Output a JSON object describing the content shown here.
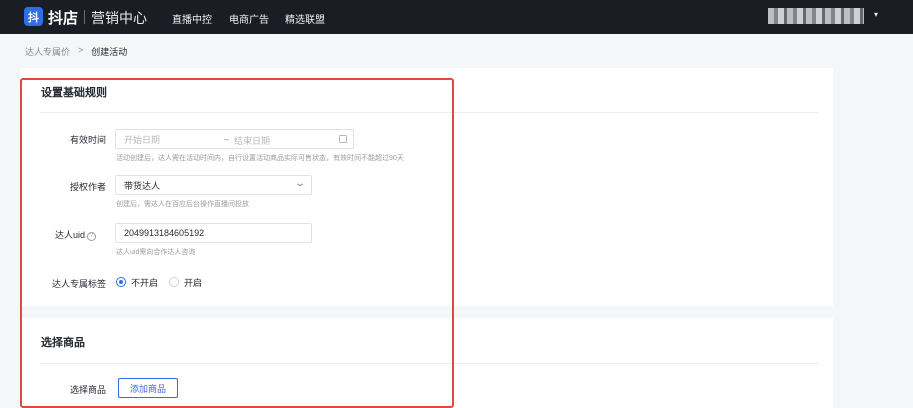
{
  "topbar": {
    "logo_icon": "抖",
    "logo_text": "抖店",
    "logo_sub": "营销中心",
    "nav": [
      "直播中控",
      "电商广告",
      "精选联盟"
    ],
    "caret": "▾"
  },
  "breadcrumb": {
    "parent": "达人专属价",
    "separator": ">",
    "current": "创建活动"
  },
  "section1": {
    "title": "设置基础规则",
    "valid_time": {
      "label": "有效时间",
      "start_placeholder": "开始日期",
      "separator": "–",
      "end_placeholder": "结束日期",
      "hint": "活动创建后，达人需在活动时间内，自行设置活动商品实际可售状态，有效时间不能超过90天"
    },
    "author": {
      "label": "授权作者",
      "value": "带货达人",
      "hint": "创建后，需达人在百应后台操作直播间投放"
    },
    "uid": {
      "label": "达人uid",
      "help": "?",
      "value": "2049913184605192",
      "hint": "达人uid需向合作达人咨询"
    },
    "tag": {
      "label": "达人专属标签",
      "options": [
        "不开启",
        "开启"
      ],
      "selected": "不开启"
    }
  },
  "section2": {
    "title": "选择商品",
    "label": "选择商品",
    "add_button": "添加商品"
  },
  "colors": {
    "topbar": "#1a1d24",
    "accent": "#2f6ee8",
    "highlight": "#e6463c"
  }
}
